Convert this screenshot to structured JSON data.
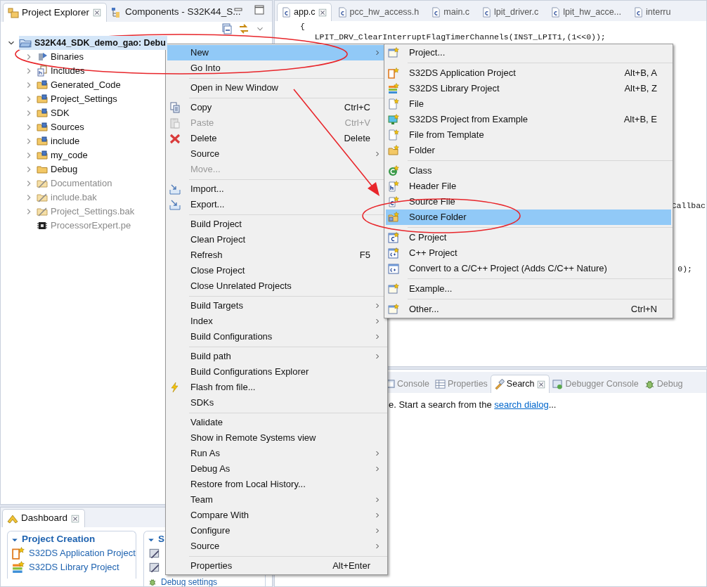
{
  "explorer": {
    "tabs": [
      {
        "label": "Project Explorer",
        "selected": true,
        "closable": true
      },
      {
        "label": "Components - S32K44_S...",
        "selected": false,
        "closable": false
      }
    ],
    "tree": [
      {
        "label": "S32K44_SDK_demo_gao: Debu",
        "expanded": true,
        "selected": true,
        "dimmed": false,
        "children": [
          {
            "label": "Binaries",
            "expanded": false,
            "selected": false,
            "dimmed": false
          },
          {
            "label": "Includes",
            "expanded": false,
            "selected": false,
            "dimmed": false
          },
          {
            "label": "Generated_Code",
            "expanded": false,
            "selected": false,
            "dimmed": false
          },
          {
            "label": "Project_Settings",
            "expanded": false,
            "selected": false,
            "dimmed": false
          },
          {
            "label": "SDK",
            "expanded": false,
            "selected": false,
            "dimmed": false
          },
          {
            "label": "Sources",
            "expanded": false,
            "selected": false,
            "dimmed": false
          },
          {
            "label": "include",
            "expanded": false,
            "selected": false,
            "dimmed": false
          },
          {
            "label": "my_code",
            "expanded": false,
            "selected": false,
            "dimmed": false
          },
          {
            "label": "Debug",
            "expanded": false,
            "selected": false,
            "dimmed": false
          },
          {
            "label": "Documentation",
            "expanded": false,
            "selected": false,
            "dimmed": true
          },
          {
            "label": "include.bak",
            "expanded": false,
            "selected": false,
            "dimmed": true
          },
          {
            "label": "Project_Settings.bak",
            "expanded": false,
            "selected": false,
            "dimmed": true
          },
          {
            "label": "ProcessorExpert.pe",
            "selected": false,
            "dimmed": true
          }
        ]
      }
    ]
  },
  "editor": {
    "tabs": [
      {
        "label": "app.c",
        "selected": true
      },
      {
        "label": "pcc_hw_access.h",
        "selected": false
      },
      {
        "label": "main.c",
        "selected": false
      },
      {
        "label": "lpit_driver.c",
        "selected": false
      },
      {
        "label": "lpit_hw_acce...",
        "selected": false
      },
      {
        "label": "interru",
        "selected": false
      }
    ],
    "code_lines": [
      {
        "text": "{"
      },
      {
        "text": "   LPIT_DRV_ClearInterruptFlagTimerChannels(INST_LPIT1,(1<<0));"
      }
    ],
    "code_fragments": [
      {
        "text": "Callbac"
      },
      {
        "text": "0);"
      }
    ]
  },
  "bottom_panel": {
    "tabs": [
      {
        "label": "Console",
        "selected": false,
        "closable": false
      },
      {
        "label": "Properties",
        "selected": false,
        "closable": false
      },
      {
        "label": "Search",
        "selected": true,
        "closable": true
      },
      {
        "label": "Debugger Console",
        "selected": false,
        "closable": false
      },
      {
        "label": "Debug",
        "selected": false,
        "closable": false
      }
    ],
    "message": {
      "prefix": "e. Start a search from the ",
      "link": "search dialog",
      "suffix": "..."
    }
  },
  "dashboard": {
    "tab": {
      "label": "Dashboard",
      "selected": true
    },
    "sections": [
      {
        "title": "Project Creation",
        "expanded": true,
        "items": [
          {
            "kind": "link",
            "label": "S32DS Application Project"
          },
          {
            "kind": "link",
            "label": "S32DS Library Project"
          }
        ]
      },
      {
        "title": "S",
        "expanded": true,
        "items": [
          {
            "kind": "hidden"
          },
          {
            "kind": "hidden"
          },
          {
            "kind": "link",
            "label": "Debug settings"
          }
        ]
      }
    ]
  },
  "context_menu": {
    "items": [
      {
        "kind": "item",
        "label": "New",
        "submenu": true,
        "selected": true,
        "disabled": false
      },
      {
        "kind": "item",
        "label": "Go Into",
        "submenu": false,
        "selected": false,
        "disabled": false
      },
      {
        "kind": "separator"
      },
      {
        "kind": "item",
        "label": "Open in New Window",
        "submenu": false,
        "selected": false,
        "disabled": false
      },
      {
        "kind": "separator"
      },
      {
        "kind": "item",
        "label": "Copy",
        "shortcut": "Ctrl+C",
        "submenu": false,
        "selected": false,
        "disabled": false
      },
      {
        "kind": "item",
        "label": "Paste",
        "shortcut": "Ctrl+V",
        "submenu": false,
        "selected": false,
        "disabled": true
      },
      {
        "kind": "item",
        "label": "Delete",
        "shortcut": "Delete",
        "submenu": false,
        "selected": false,
        "disabled": false
      },
      {
        "kind": "item",
        "label": "Source",
        "submenu": true,
        "selected": false,
        "disabled": false
      },
      {
        "kind": "item",
        "label": "Move...",
        "submenu": false,
        "selected": false,
        "disabled": true
      },
      {
        "kind": "separator"
      },
      {
        "kind": "item",
        "label": "Import...",
        "submenu": false,
        "selected": false,
        "disabled": false
      },
      {
        "kind": "item",
        "label": "Export...",
        "submenu": false,
        "selected": false,
        "disabled": false
      },
      {
        "kind": "separator"
      },
      {
        "kind": "item",
        "label": "Build Project",
        "submenu": false,
        "selected": false,
        "disabled": false
      },
      {
        "kind": "item",
        "label": "Clean Project",
        "submenu": false,
        "selected": false,
        "disabled": false
      },
      {
        "kind": "item",
        "label": "Refresh",
        "shortcut": "F5",
        "submenu": false,
        "selected": false,
        "disabled": false
      },
      {
        "kind": "item",
        "label": "Close Project",
        "submenu": false,
        "selected": false,
        "disabled": false
      },
      {
        "kind": "item",
        "label": "Close Unrelated Projects",
        "submenu": false,
        "selected": false,
        "disabled": false
      },
      {
        "kind": "separator"
      },
      {
        "kind": "item",
        "label": "Build Targets",
        "submenu": true,
        "selected": false,
        "disabled": false
      },
      {
        "kind": "item",
        "label": "Index",
        "submenu": true,
        "selected": false,
        "disabled": false
      },
      {
        "kind": "item",
        "label": "Build Configurations",
        "submenu": true,
        "selected": false,
        "disabled": false
      },
      {
        "kind": "separator"
      },
      {
        "kind": "item",
        "label": "Build path",
        "submenu": true,
        "selected": false,
        "disabled": false
      },
      {
        "kind": "item",
        "label": "Build Configurations Explorer",
        "submenu": false,
        "selected": false,
        "disabled": false
      },
      {
        "kind": "item",
        "label": "Flash from file...",
        "submenu": false,
        "selected": false,
        "disabled": false
      },
      {
        "kind": "item",
        "label": "SDKs",
        "submenu": false,
        "selected": false,
        "disabled": false
      },
      {
        "kind": "separator"
      },
      {
        "kind": "item",
        "label": "Validate",
        "submenu": false,
        "selected": false,
        "disabled": false
      },
      {
        "kind": "item",
        "label": "Show in Remote Systems view",
        "submenu": false,
        "selected": false,
        "disabled": false
      },
      {
        "kind": "item",
        "label": "Run As",
        "submenu": true,
        "selected": false,
        "disabled": false
      },
      {
        "kind": "item",
        "label": "Debug As",
        "submenu": true,
        "selected": false,
        "disabled": false
      },
      {
        "kind": "item",
        "label": "Restore from Local History...",
        "submenu": false,
        "selected": false,
        "disabled": false
      },
      {
        "kind": "item",
        "label": "Team",
        "submenu": true,
        "selected": false,
        "disabled": false
      },
      {
        "kind": "item",
        "label": "Compare With",
        "submenu": true,
        "selected": false,
        "disabled": false
      },
      {
        "kind": "item",
        "label": "Configure",
        "submenu": true,
        "selected": false,
        "disabled": false
      },
      {
        "kind": "item",
        "label": "Source",
        "submenu": true,
        "selected": false,
        "disabled": false
      },
      {
        "kind": "separator"
      },
      {
        "kind": "item",
        "label": "Properties",
        "shortcut": "Alt+Enter",
        "submenu": false,
        "selected": false,
        "disabled": false
      }
    ]
  },
  "submenu": {
    "items": [
      {
        "kind": "item",
        "label": "Project...",
        "selected": false
      },
      {
        "kind": "separator"
      },
      {
        "kind": "item",
        "label": "S32DS Application Project",
        "shortcut": "Alt+B, A",
        "selected": false
      },
      {
        "kind": "item",
        "label": "S32DS Library Project",
        "shortcut": "Alt+B, Z",
        "selected": false
      },
      {
        "kind": "item",
        "label": "File",
        "selected": false
      },
      {
        "kind": "item",
        "label": "S32DS Project from Example",
        "shortcut": "Alt+B, E",
        "selected": false
      },
      {
        "kind": "item",
        "label": "File from Template",
        "selected": false
      },
      {
        "kind": "item",
        "label": "Folder",
        "selected": false
      },
      {
        "kind": "separator"
      },
      {
        "kind": "item",
        "label": "Class",
        "selected": false
      },
      {
        "kind": "item",
        "label": "Header File",
        "selected": false
      },
      {
        "kind": "item",
        "label": "Source File",
        "selected": false
      },
      {
        "kind": "item",
        "label": "Source Folder",
        "selected": true
      },
      {
        "kind": "separator"
      },
      {
        "kind": "item",
        "label": "C Project",
        "selected": false
      },
      {
        "kind": "item",
        "label": "C++ Project",
        "selected": false
      },
      {
        "kind": "item",
        "label": "Convert to a C/C++ Project (Adds C/C++ Nature)",
        "selected": false
      },
      {
        "kind": "separator"
      },
      {
        "kind": "item",
        "label": "Example...",
        "selected": false
      },
      {
        "kind": "separator"
      },
      {
        "kind": "item",
        "label": "Other...",
        "shortcut": "Ctrl+N",
        "selected": false
      }
    ]
  },
  "annotations": [
    {
      "kind": "ellipse"
    },
    {
      "kind": "arrow"
    },
    {
      "kind": "ellipse"
    }
  ]
}
